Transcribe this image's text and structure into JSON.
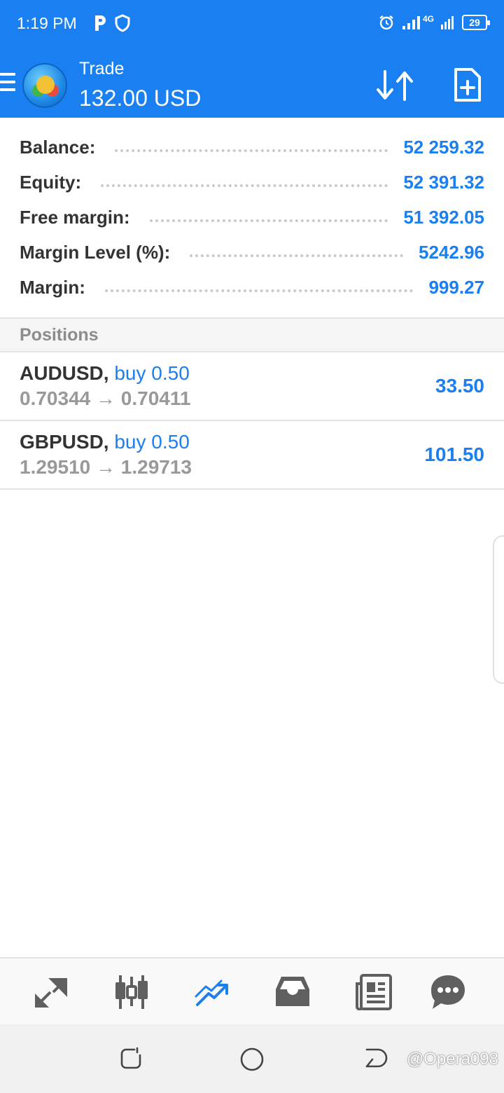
{
  "status_bar": {
    "time": "1:19 PM",
    "battery": "29",
    "network": "4G"
  },
  "app_bar": {
    "title": "Trade",
    "subtitle": "132.00 USD"
  },
  "summary": [
    {
      "label": "Balance:",
      "value": "52 259.32"
    },
    {
      "label": "Equity:",
      "value": "52 391.32"
    },
    {
      "label": "Free margin:",
      "value": "51 392.05"
    },
    {
      "label": "Margin Level (%):",
      "value": "5242.96"
    },
    {
      "label": "Margin:",
      "value": "999.27"
    }
  ],
  "positions_header": "Positions",
  "positions": [
    {
      "symbol": "AUDUSD,",
      "side": "buy 0.50",
      "prices": "0.70344 → 0.70411",
      "profit": "33.50"
    },
    {
      "symbol": "GBPUSD,",
      "side": "buy 0.50",
      "prices": "1.29510 → 1.29713",
      "profit": "101.50"
    }
  ],
  "bottom_nav": [
    "quotes-icon",
    "chart-icon",
    "trade-icon",
    "history-icon",
    "news-icon",
    "chat-icon"
  ],
  "watermark": "@Opera098",
  "colors": {
    "accent": "#1a7ff0",
    "label": "#333333",
    "muted": "#999999"
  }
}
